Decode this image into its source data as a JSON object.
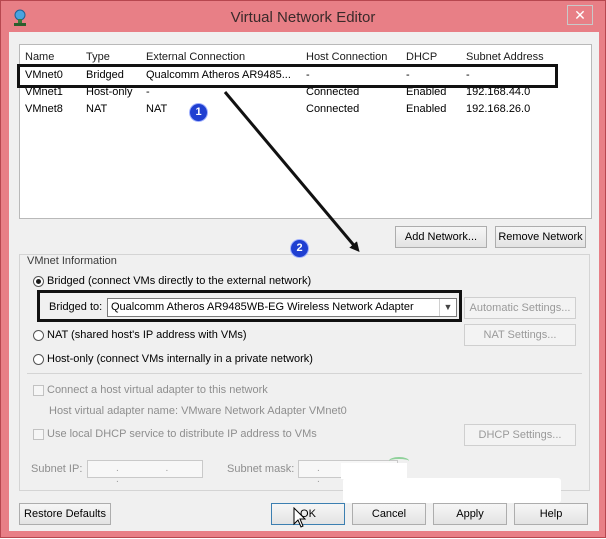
{
  "window": {
    "title": "Virtual Network Editor",
    "close_label": "✕",
    "accent_color": "#e87f86"
  },
  "network_list": {
    "columns": [
      "Name",
      "Type",
      "External Connection",
      "Host Connection",
      "DHCP",
      "Subnet Address"
    ],
    "rows": [
      {
        "name": "VMnet0",
        "type": "Bridged",
        "external": "Qualcomm Atheros AR9485...",
        "host": "-",
        "dhcp": "-",
        "subnet": "-"
      },
      {
        "name": "VMnet1",
        "type": "Host-only",
        "external": "-",
        "host": "Connected",
        "dhcp": "Enabled",
        "subnet": "192.168.44.0"
      },
      {
        "name": "VMnet8",
        "type": "NAT",
        "external": "NAT",
        "host": "Connected",
        "dhcp": "Enabled",
        "subnet": "192.168.26.0"
      }
    ],
    "add_label": "Add Network...",
    "remove_label": "Remove Network"
  },
  "vmnet_info": {
    "title": "VMnet Information",
    "bridged_label": "Bridged (connect VMs directly to the external network)",
    "bridged_to_label": "Bridged to:",
    "bridged_to_value": "Qualcomm Atheros AR9485WB-EG Wireless Network Adapter",
    "automatic_settings_label": "Automatic Settings...",
    "nat_label": "NAT (shared host's IP address with VMs)",
    "nat_settings_label": "NAT Settings...",
    "hostonly_label": "Host-only (connect VMs internally in a private network)",
    "connect_adapter_label": "Connect a host virtual adapter to this network",
    "adapter_name_label": "Host virtual adapter name: VMware Network Adapter VMnet0",
    "dhcp_label": "Use local DHCP service to distribute IP address to VMs",
    "dhcp_settings_label": "DHCP Settings...",
    "subnet_ip_label": "Subnet IP:",
    "subnet_ip_value": ". . .",
    "subnet_mask_label": "Subnet mask:",
    "subnet_mask_value": ". . ."
  },
  "footer": {
    "restore_label": "Restore Defaults",
    "ok_label": "OK",
    "cancel_label": "Cancel",
    "apply_label": "Apply",
    "help_label": "Help"
  },
  "annotations": {
    "badge1": "1",
    "badge2": "2"
  }
}
